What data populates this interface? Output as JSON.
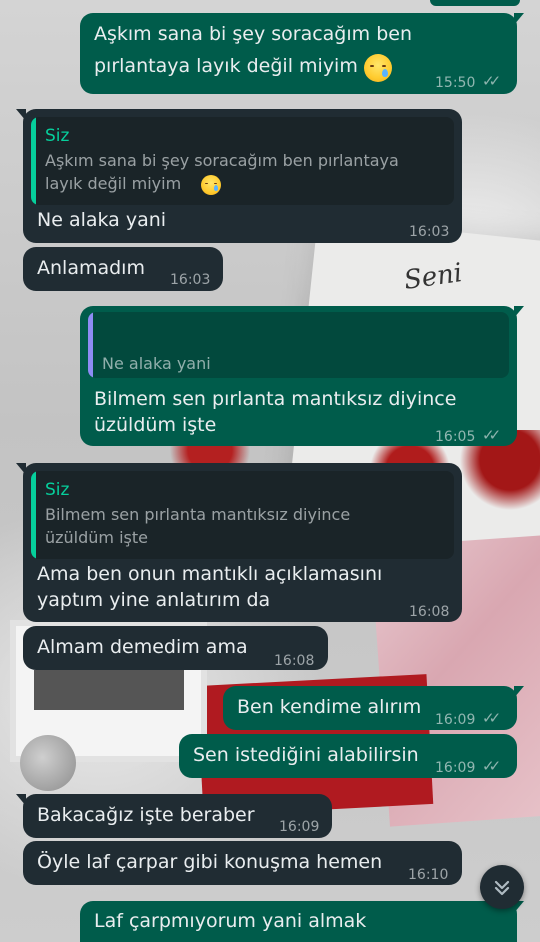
{
  "messages": [
    {
      "dir": "out",
      "text_lines": [
        "Aşkım sana bi şey soracağım ben",
        "pırlantaya layık değil miyim"
      ],
      "emoji": "crying-face",
      "time": "15:50",
      "status": "read"
    },
    {
      "dir": "in",
      "quote": {
        "sender": "Siz",
        "lines": [
          "Aşkım sana bi şey soracağım ben pırlantaya",
          "layık değil miyim"
        ],
        "emoji": "crying-face"
      },
      "text_lines": [
        "Ne alaka yani"
      ],
      "time": "16:03"
    },
    {
      "dir": "in",
      "text_lines": [
        "Anlamadım"
      ],
      "time": "16:03"
    },
    {
      "dir": "out",
      "quote": {
        "sender": "",
        "lines": [
          "Ne alaka yani"
        ]
      },
      "text_lines": [
        "Bilmem sen pırlanta mantıksız diyince",
        "üzüldüm işte"
      ],
      "time": "16:05",
      "status": "read"
    },
    {
      "dir": "in",
      "quote": {
        "sender": "Siz",
        "lines": [
          "Bilmem sen pırlanta mantıksız diyince",
          "üzüldüm işte"
        ]
      },
      "text_lines": [
        "Ama ben onun mantıklı açıklamasını",
        "yaptım yine anlatırım da"
      ],
      "time": "16:08"
    },
    {
      "dir": "in",
      "text_lines": [
        "Almam demedim ama"
      ],
      "time": "16:08"
    },
    {
      "dir": "out",
      "text_lines": [
        "Ben kendime alırım"
      ],
      "time": "16:09",
      "status": "read"
    },
    {
      "dir": "out",
      "text_lines": [
        "Sen istediğini alabilirsin"
      ],
      "time": "16:09",
      "status": "read"
    },
    {
      "dir": "in",
      "text_lines": [
        "Bakacağız işte beraber"
      ],
      "time": "16:09"
    },
    {
      "dir": "in",
      "text_lines": [
        "Öyle laf çarpar gibi konuşma hemen"
      ],
      "time": "16:10"
    },
    {
      "dir": "out",
      "text_lines": [
        "Laf çarpmıyorum yani almak"
      ],
      "time": "",
      "status": ""
    }
  ],
  "wallpaper_text": "Seni",
  "icons": {
    "read_receipt": "double-check-icon",
    "scroll_down": "chevron-double-down-icon",
    "emoji": "crying-face-emoji"
  },
  "colors": {
    "incoming": "#202c33",
    "outgoing": "#005c4b",
    "quote_name": "#06cf9c",
    "quote_bar_out": "#8e8cf5"
  }
}
